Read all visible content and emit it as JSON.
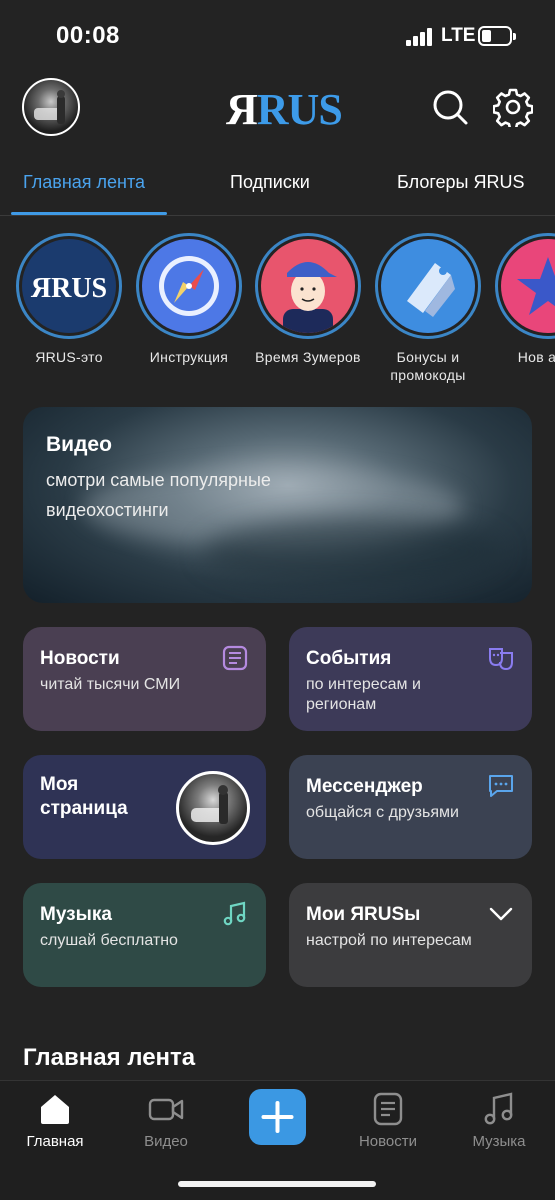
{
  "status_bar": {
    "time": "00:08",
    "network": "LTE"
  },
  "header": {
    "logo_ya": "Я",
    "logo_rus": "RUS"
  },
  "tabs": [
    {
      "label": "Главная лента",
      "active": true
    },
    {
      "label": "Подписки",
      "active": false
    },
    {
      "label": "Блогеры ЯRUS",
      "active": false
    }
  ],
  "stories": [
    {
      "label": "ЯRUS-это",
      "icon": "yarus-logo"
    },
    {
      "label": "Инструкция",
      "icon": "compass-icon"
    },
    {
      "label": "Время Зумеров",
      "icon": "zoomer-avatar"
    },
    {
      "label": "Бонусы и промокоды",
      "icon": "tag-icon"
    },
    {
      "label": "Нов авто",
      "icon": "star-icon"
    }
  ],
  "video_card": {
    "title": "Видео",
    "subtitle": "смотри самые популярные видеохостинги"
  },
  "cards": {
    "news": {
      "title": "Новости",
      "subtitle": "читай тысячи СМИ",
      "icon": "news-icon"
    },
    "events": {
      "title": "События",
      "subtitle": "по интересам и регионам",
      "icon": "theater-masks-icon"
    },
    "mypage": {
      "title": "Моя страница"
    },
    "messenger": {
      "title": "Мессенджер",
      "subtitle": "общайся с друзьями",
      "icon": "chat-icon"
    },
    "music": {
      "title": "Музыка",
      "subtitle": "слушай бесплатно",
      "icon": "music-note-icon"
    },
    "myrus": {
      "title": "Мои ЯRUSы",
      "subtitle": "настрой по интересам",
      "icon": "chevron-down-icon"
    }
  },
  "feed_heading": "Главная лента",
  "bottom_nav": [
    {
      "label": "Главная",
      "icon": "home-icon",
      "active": true
    },
    {
      "label": "Видео",
      "icon": "video-camera-icon",
      "active": false
    },
    {
      "label": "",
      "icon": "plus-icon",
      "active": false
    },
    {
      "label": "Новости",
      "icon": "news-icon",
      "active": false
    },
    {
      "label": "Музыка",
      "icon": "music-note-icon",
      "active": false
    }
  ],
  "colors": {
    "accent": "#3b98e3",
    "background": "#232323"
  }
}
